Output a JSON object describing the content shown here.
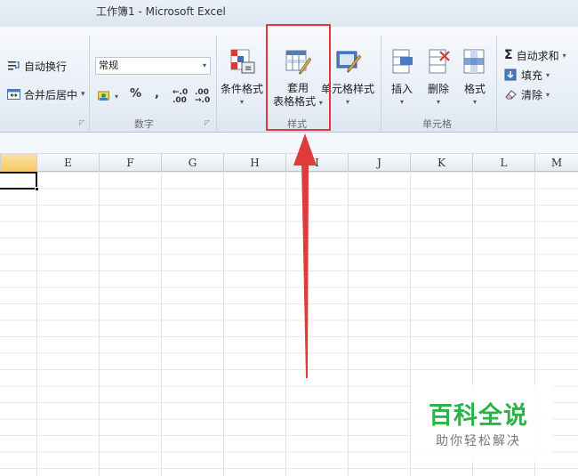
{
  "window": {
    "title": "工作簿1  -  Microsoft Excel"
  },
  "alignment": {
    "wrap_text": "自动换行",
    "merge_center": "合并后居中",
    "merge_dropdown": "▾"
  },
  "number": {
    "format_value": "常规",
    "percent": "%",
    "comma": ",",
    "increase_decimal": "←.0 .00",
    "decrease_decimal": ".00 →.0",
    "group_label": "数字"
  },
  "styles": {
    "conditional_formatting": "条件格式",
    "format_as_table_line1": "套用",
    "format_as_table_line2": "表格格式",
    "cell_styles": "单元格样式",
    "group_label": "样式"
  },
  "cells": {
    "insert": "插入",
    "delete": "删除",
    "format": "格式",
    "group_label": "单元格"
  },
  "editing": {
    "autosum": "自动求和",
    "fill": "填充",
    "clear": "清除"
  },
  "sheet": {
    "selected_column": "",
    "columns": [
      "E",
      "F",
      "G",
      "H",
      "I",
      "J",
      "K",
      "L",
      "M"
    ]
  },
  "watermark": {
    "title": "百科全说",
    "subtitle": "助你轻松解决"
  },
  "colors": {
    "highlight": "#e13a3a",
    "watermark_green": "#2bb34a",
    "selected_header": "#f6c764"
  }
}
